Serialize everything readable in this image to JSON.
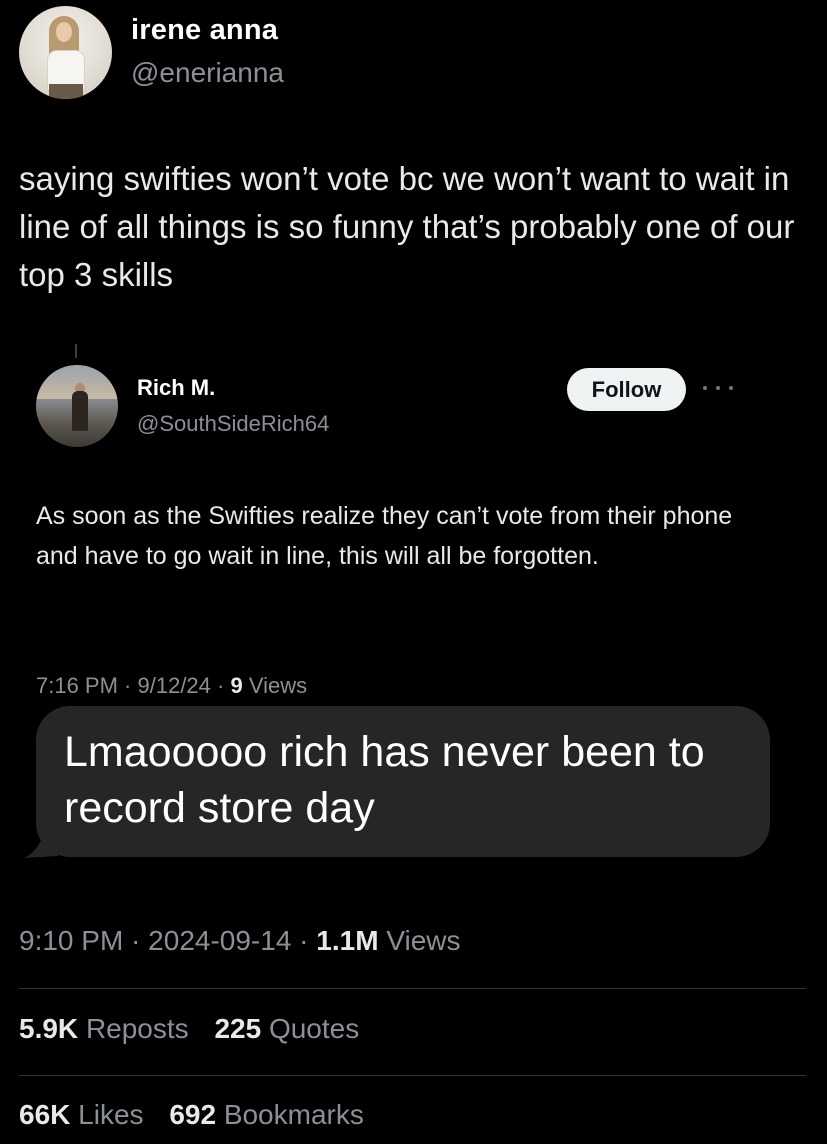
{
  "author": {
    "name": "irene anna",
    "handle": "@enerianna"
  },
  "tweet": {
    "text": "saying swifties won’t vote bc we won’t want to wait in line of all things is so funny that’s probably one of our top 3 skills",
    "time": "9:10 PM",
    "date": "2024-09-14",
    "views_count": "1.1M",
    "views_label": "Views"
  },
  "quoted": {
    "name": "Rich M.",
    "handle": "@SouthSideRich64",
    "follow_label": "Follow",
    "more_icon": "more-horizontal-icon",
    "text": "As soon as the Swifties realize they can’t vote from their phone and have to go wait in line, this will all be forgotten.",
    "time": "7:16 PM",
    "date": "9/12/24",
    "views_count": "9",
    "views_label": "Views"
  },
  "message_bubble": {
    "text": "Lmaooooo rich has never been to record store day",
    "color": "#262628"
  },
  "stats": {
    "reposts_count": "5.9K",
    "reposts_label": "Reposts",
    "quotes_count": "225",
    "quotes_label": "Quotes",
    "likes_count": "66K",
    "likes_label": "Likes",
    "bookmarks_count": "692",
    "bookmarks_label": "Bookmarks"
  },
  "colors": {
    "background": "#000000",
    "primary_text": "#e7e9ea",
    "secondary_text": "#8b9096",
    "divider": "#2f3336",
    "follow_button_bg": "#eff3f4"
  }
}
